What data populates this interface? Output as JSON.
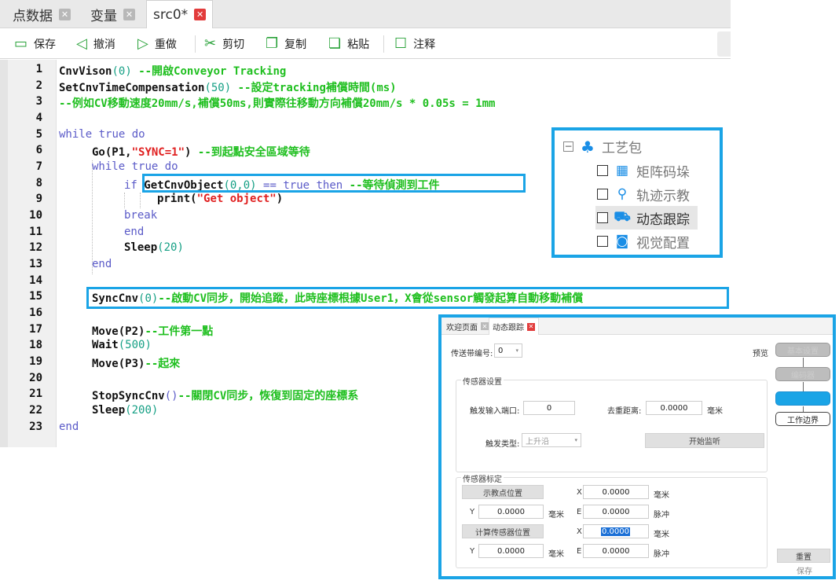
{
  "tabs": [
    {
      "label": "点数据",
      "active": false
    },
    {
      "label": "变量",
      "active": false
    },
    {
      "label": "src0*",
      "active": true
    }
  ],
  "toolbar": {
    "save": "保存",
    "undo": "撤消",
    "redo": "重做",
    "cut": "剪切",
    "copy": "复制",
    "paste": "粘贴",
    "comment": "注释"
  },
  "code": {
    "line_numbers": [
      "1",
      "2",
      "3",
      "4",
      "5",
      "6",
      "7",
      "8",
      "9",
      "10",
      "11",
      "12",
      "13",
      "14",
      "15",
      "16",
      "17",
      "18",
      "19",
      "20",
      "21",
      "22",
      "23"
    ],
    "l1_fn": "CnvVison",
    "l1_arg": "0",
    "l1_comment": "--開啟Conveyor Tracking",
    "l2_fn": "SetCnvTimeCompensation",
    "l2_arg": "50",
    "l2_comment": "--設定tracking補償時間(ms)",
    "l3_comment": "--例如CV移動速度20mm/s,補償50ms,則實際往移動方向補償20mm/s * 0.05s = 1mm",
    "kw_while": "while",
    "kw_true": "true",
    "kw_do": "do",
    "kw_if": "if",
    "kw_then": "then",
    "kw_break": "break",
    "kw_end": "end",
    "l6_fn": "Go",
    "l6_p": "P1,",
    "l6_str": "\"SYNC=1\"",
    "l6_comment": "--到起點安全區域等待",
    "l8_fn": "GetCnvObject",
    "l8_args": "(0,0)",
    "l8_op": "==",
    "l8_comment": "--等待偵測到工件",
    "l9_fn": "print",
    "l9_str": "\"Get object\"",
    "l12_fn": "Sleep",
    "l12_arg": "20",
    "l15_fn": "SyncCnv",
    "l15_arg": "0",
    "l15_comment": "--啟動CV同步，開始追蹤，此時座標根據User1，X會從sensor觸發起算自動移動補償",
    "l17_fn": "Move",
    "l17_arg": "P2",
    "l17_comment": "--工件第一點",
    "l18_fn": "Wait",
    "l18_arg": "500",
    "l19_fn": "Move",
    "l19_arg": "P3",
    "l19_comment": "--起來",
    "l21_fn": "StopSyncCnv",
    "l21_comment": "--關閉CV同步，恢復到固定的座標系",
    "l22_fn": "Sleep",
    "l22_arg": "200"
  },
  "package": {
    "title": "工艺包",
    "items": [
      {
        "label": "矩阵码垛",
        "icon": "grid-icon"
      },
      {
        "label": "轨迹示教",
        "icon": "location-pin-icon"
      },
      {
        "label": "动态跟踪",
        "icon": "conveyor-icon",
        "selected": true
      },
      {
        "label": "视觉配置",
        "icon": "camera-icon"
      }
    ]
  },
  "dialog": {
    "tabs": [
      "欢迎页面",
      "动态跟踪"
    ],
    "conveyor_label": "传送带编号:",
    "conveyor_value": "0",
    "preview_button": "预览",
    "flow": [
      "基本设置",
      "编码器",
      "",
      "工作边界"
    ],
    "sensor_group": "传感器设置",
    "trigger_port_label": "触发输入端口:",
    "trigger_port_value": "0",
    "dedup_label": "去重距离:",
    "dedup_value": "0.0000",
    "unit_mm": "毫米",
    "unit_pulse": "脉冲",
    "trigger_type_label": "触发类型:",
    "trigger_type_value": "上升沿",
    "start_listen": "开始监听",
    "calib_group": "传感器标定",
    "teach_pos_button": "示教点位置",
    "calc_sensor_button": "计算传感器位置",
    "axis_x": "X",
    "axis_y": "Y",
    "axis_e": "E",
    "teach_x": "0.0000",
    "teach_y": "0.0000",
    "teach_e": "0.0000",
    "calc_x": "0.0000",
    "calc_y": "0.0000",
    "calc_e": "0.0000",
    "reset_button": "重置",
    "save_button": "保存"
  }
}
